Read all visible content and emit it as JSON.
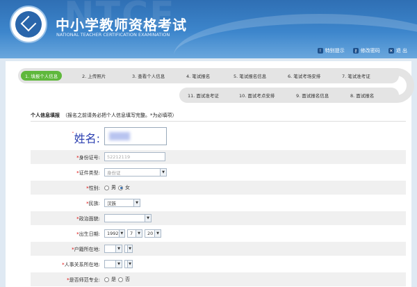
{
  "header": {
    "bg_text": "NTCE",
    "title": "中小学教师资格考试",
    "subtitle": "NATIONAL TEACHER CERTIFICATION EXAMINATION",
    "links": [
      {
        "label": "特别提示",
        "icon": "notice-icon"
      },
      {
        "label": "修改密码",
        "icon": "key-icon"
      },
      {
        "label": "退 出",
        "icon": "exit-icon"
      }
    ]
  },
  "steps": {
    "row1": [
      {
        "label": "1. 填报个人信息",
        "active": true
      },
      {
        "label": "2. 上传照片"
      },
      {
        "label": "3. 查看个人信息"
      },
      {
        "label": "4. 笔试报名"
      },
      {
        "label": "5. 笔试报名信息"
      },
      {
        "label": "6. 笔试考场安排"
      },
      {
        "label": "7. 笔试准考证"
      }
    ],
    "row2": [
      {
        "label": "11. 面试准考证"
      },
      {
        "label": "10. 面试考点安排"
      },
      {
        "label": "9. 面试报名信息"
      },
      {
        "label": "8. 面试报名"
      }
    ]
  },
  "section": {
    "title": "个人信息填报",
    "note": "（报名之前请务必把个人信息填写完整。*为必填项）"
  },
  "form": {
    "name_label": "姓名:",
    "id_label": "身份证号:",
    "id_value": "52212119",
    "doc_type_label": "证件类型:",
    "doc_type_value": "身份证",
    "gender_label": "性别:",
    "gender_male": "男",
    "gender_female": "女",
    "ethnic_label": "民族:",
    "ethnic_value": "汉族",
    "political_label": "政治面貌:",
    "birth_label": "出生日期:",
    "birth_year": "1992",
    "birth_month": "7",
    "birth_day": "20",
    "hukou_label": "户籍所在地:",
    "personnel_label": "人事关系所在地:",
    "normal_label": "是否师范专业:",
    "normal_yes": "是",
    "normal_no": "否"
  }
}
